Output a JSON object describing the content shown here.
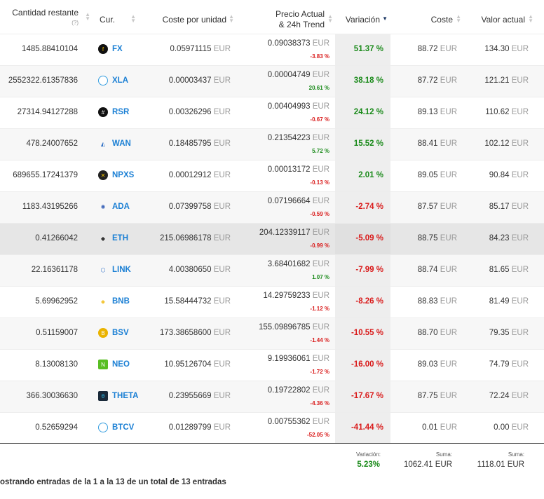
{
  "headers": {
    "cantidad": "Cantidad restante",
    "cantidad_hint": "(?)",
    "cur": "Cur.",
    "coste_unidad": "Coste por unidad",
    "precio_line1": "Precio Actual",
    "precio_line2": "& 24h Trend",
    "variacion": "Variación",
    "coste": "Coste",
    "valor": "Valor actual"
  },
  "currency_unit": "EUR",
  "rows": [
    {
      "qty": "1485.88410104",
      "sym": "FX",
      "icon": "fx-icon",
      "unit_cost": "0.05971115",
      "price": "0.09038373",
      "trend": "-3.83 %",
      "trend_dir": "neg",
      "var": "51.37 %",
      "var_dir": "pos",
      "cost": "88.72",
      "value": "134.30"
    },
    {
      "qty": "2552322.61357836",
      "sym": "XLA",
      "icon": "xla-icon",
      "unit_cost": "0.00003437",
      "price": "0.00004749",
      "trend": "20.61 %",
      "trend_dir": "pos",
      "var": "38.18 %",
      "var_dir": "pos",
      "cost": "87.72",
      "value": "121.21"
    },
    {
      "qty": "27314.94127288",
      "sym": "RSR",
      "icon": "rsr-icon",
      "unit_cost": "0.00326296",
      "price": "0.00404993",
      "trend": "-0.67 %",
      "trend_dir": "neg",
      "var": "24.12 %",
      "var_dir": "pos",
      "cost": "89.13",
      "value": "110.62"
    },
    {
      "qty": "478.24007652",
      "sym": "WAN",
      "icon": "wan-icon",
      "unit_cost": "0.18485795",
      "price": "0.21354223",
      "trend": "5.72 %",
      "trend_dir": "pos",
      "var": "15.52 %",
      "var_dir": "pos",
      "cost": "88.41",
      "value": "102.12"
    },
    {
      "qty": "689655.17241379",
      "sym": "NPXS",
      "icon": "npxs-icon",
      "unit_cost": "0.00012912",
      "price": "0.00013172",
      "trend": "-0.13 %",
      "trend_dir": "neg",
      "var": "2.01 %",
      "var_dir": "pos",
      "cost": "89.05",
      "value": "90.84"
    },
    {
      "qty": "1183.43195266",
      "sym": "ADA",
      "icon": "ada-icon",
      "unit_cost": "0.07399758",
      "price": "0.07196664",
      "trend": "-0.59 %",
      "trend_dir": "neg",
      "var": "-2.74 %",
      "var_dir": "neg",
      "cost": "87.57",
      "value": "85.17"
    },
    {
      "qty": "0.41266042",
      "sym": "ETH",
      "icon": "eth-icon",
      "unit_cost": "215.06986178",
      "price": "204.12339117",
      "trend": "-0.99 %",
      "trend_dir": "neg",
      "var": "-5.09 %",
      "var_dir": "neg",
      "cost": "88.75",
      "value": "84.23"
    },
    {
      "qty": "22.16361178",
      "sym": "LINK",
      "icon": "link-icon",
      "unit_cost": "4.00380650",
      "price": "3.68401682",
      "trend": "1.07 %",
      "trend_dir": "pos",
      "var": "-7.99 %",
      "var_dir": "neg",
      "cost": "88.74",
      "value": "81.65"
    },
    {
      "qty": "5.69962952",
      "sym": "BNB",
      "icon": "bnb-icon",
      "unit_cost": "15.58444732",
      "price": "14.29759233",
      "trend": "-1.12 %",
      "trend_dir": "neg",
      "var": "-8.26 %",
      "var_dir": "neg",
      "cost": "88.83",
      "value": "81.49"
    },
    {
      "qty": "0.51159007",
      "sym": "BSV",
      "icon": "bsv-icon",
      "unit_cost": "173.38658600",
      "price": "155.09896785",
      "trend": "-1.44 %",
      "trend_dir": "neg",
      "var": "-10.55 %",
      "var_dir": "neg",
      "cost": "88.70",
      "value": "79.35"
    },
    {
      "qty": "8.13008130",
      "sym": "NEO",
      "icon": "neo-icon",
      "unit_cost": "10.95126704",
      "price": "9.19936061",
      "trend": "-1.72 %",
      "trend_dir": "neg",
      "var": "-16.00 %",
      "var_dir": "neg",
      "cost": "89.03",
      "value": "74.79"
    },
    {
      "qty": "366.30036630",
      "sym": "THETA",
      "icon": "theta-icon",
      "unit_cost": "0.23955669",
      "price": "0.19722802",
      "trend": "-4.36 %",
      "trend_dir": "neg",
      "var": "-17.67 %",
      "var_dir": "neg",
      "cost": "87.75",
      "value": "72.24"
    },
    {
      "qty": "0.52659294",
      "sym": "BTCV",
      "icon": "btcv-icon",
      "unit_cost": "0.01289799",
      "price": "0.00755362",
      "trend": "-52.05 %",
      "trend_dir": "neg",
      "var": "-41.44 %",
      "var_dir": "neg",
      "cost": "0.01",
      "value": "0.00"
    }
  ],
  "footer": {
    "var_label": "Variación:",
    "var_value": "5.23%",
    "cost_label": "Suma:",
    "cost_value": "1062.41 EUR",
    "value_label": "Suma:",
    "value_value": "1118.01 EUR"
  },
  "info_text": "ostrando entradas de la 1 a la 13 de un total de 13 entradas",
  "colors": {
    "positive": "#1a8a1a",
    "negative": "#d91a1a",
    "link": "#1a7fd4"
  }
}
